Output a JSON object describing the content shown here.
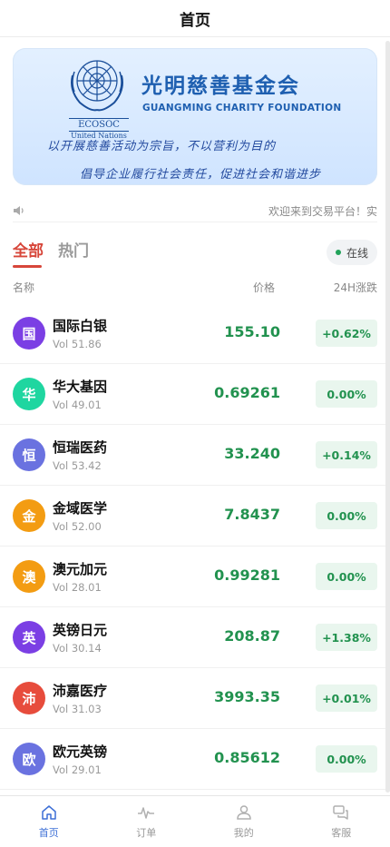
{
  "header": {
    "title": "首页"
  },
  "banner": {
    "org_cn": "光明慈善基金会",
    "org_en": "GUANGMING CHARITY FOUNDATION",
    "logo_text": "ECOSOC",
    "logo_sub": "United Nations",
    "slogan_1": "以开展慈善活动为宗旨，不以营利为目的",
    "slogan_2": "倡导企业履行社会责任，促进社会和谐进步"
  },
  "notice": {
    "icon": "speaker-icon",
    "text": "欢迎来到交易平台！实"
  },
  "tabs": {
    "all": "全部",
    "hot": "热门",
    "status": "在线"
  },
  "columns": {
    "name": "名称",
    "price": "价格",
    "change": "24H涨跌"
  },
  "colors": {
    "up": "#22924f",
    "accent": "#d7463a",
    "nav_active": "#3d6fd6"
  },
  "assets": [
    {
      "initial": "国",
      "name": "国际白银",
      "vol": "Vol 51.86",
      "price": "155.10",
      "change": "+0.62%",
      "color": "#7b3fe4"
    },
    {
      "initial": "华",
      "name": "华大基因",
      "vol": "Vol 49.01",
      "price": "0.69261",
      "change": "0.00%",
      "color": "#1fd6a0"
    },
    {
      "initial": "恒",
      "name": "恒瑞医药",
      "vol": "Vol 53.42",
      "price": "33.240",
      "change": "+0.14%",
      "color": "#6a72e0"
    },
    {
      "initial": "金",
      "name": "金域医学",
      "vol": "Vol 52.00",
      "price": "7.8437",
      "change": "0.00%",
      "color": "#f39c12"
    },
    {
      "initial": "澳",
      "name": "澳元加元",
      "vol": "Vol 28.01",
      "price": "0.99281",
      "change": "0.00%",
      "color": "#f39c12"
    },
    {
      "initial": "英",
      "name": "英镑日元",
      "vol": "Vol 30.14",
      "price": "208.87",
      "change": "+1.38%",
      "color": "#7b3fe4"
    },
    {
      "initial": "沛",
      "name": "沛嘉医疗",
      "vol": "Vol 31.03",
      "price": "3993.35",
      "change": "+0.01%",
      "color": "#e74c3c"
    },
    {
      "initial": "欧",
      "name": "欧元英镑",
      "vol": "Vol 29.01",
      "price": "0.85612",
      "change": "0.00%",
      "color": "#6a72e0"
    }
  ],
  "nav": [
    {
      "label": "首页",
      "icon": "home-icon"
    },
    {
      "label": "订单",
      "icon": "pulse-icon"
    },
    {
      "label": "我的",
      "icon": "user-icon"
    },
    {
      "label": "客服",
      "icon": "chat-icon"
    }
  ]
}
